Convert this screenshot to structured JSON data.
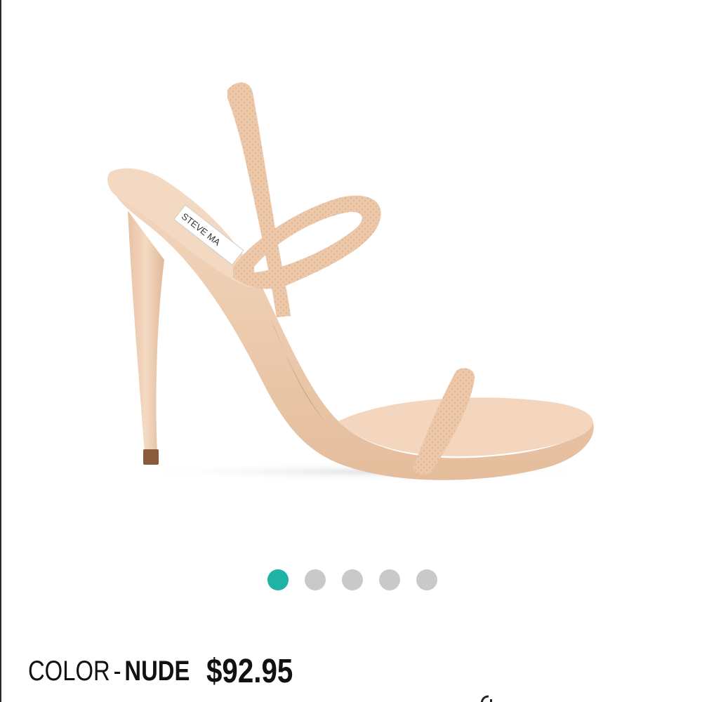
{
  "product": {
    "color_label": "COLOR",
    "color_separator": "-",
    "color_value": "NUDE",
    "price": "$92.95",
    "image_icon": "nude-strappy-heel-sandal",
    "brand_on_insole": "STEVE MA"
  },
  "carousel": {
    "total": 5,
    "active_index": 0,
    "active_color": "#1fb3a5",
    "inactive_color": "#c9c9c9"
  },
  "colors": {
    "shoe": "#f1d2b6",
    "shoe_shadow": "#dcb391",
    "heel_tip": "#8a5a3c",
    "text": "#111111"
  }
}
